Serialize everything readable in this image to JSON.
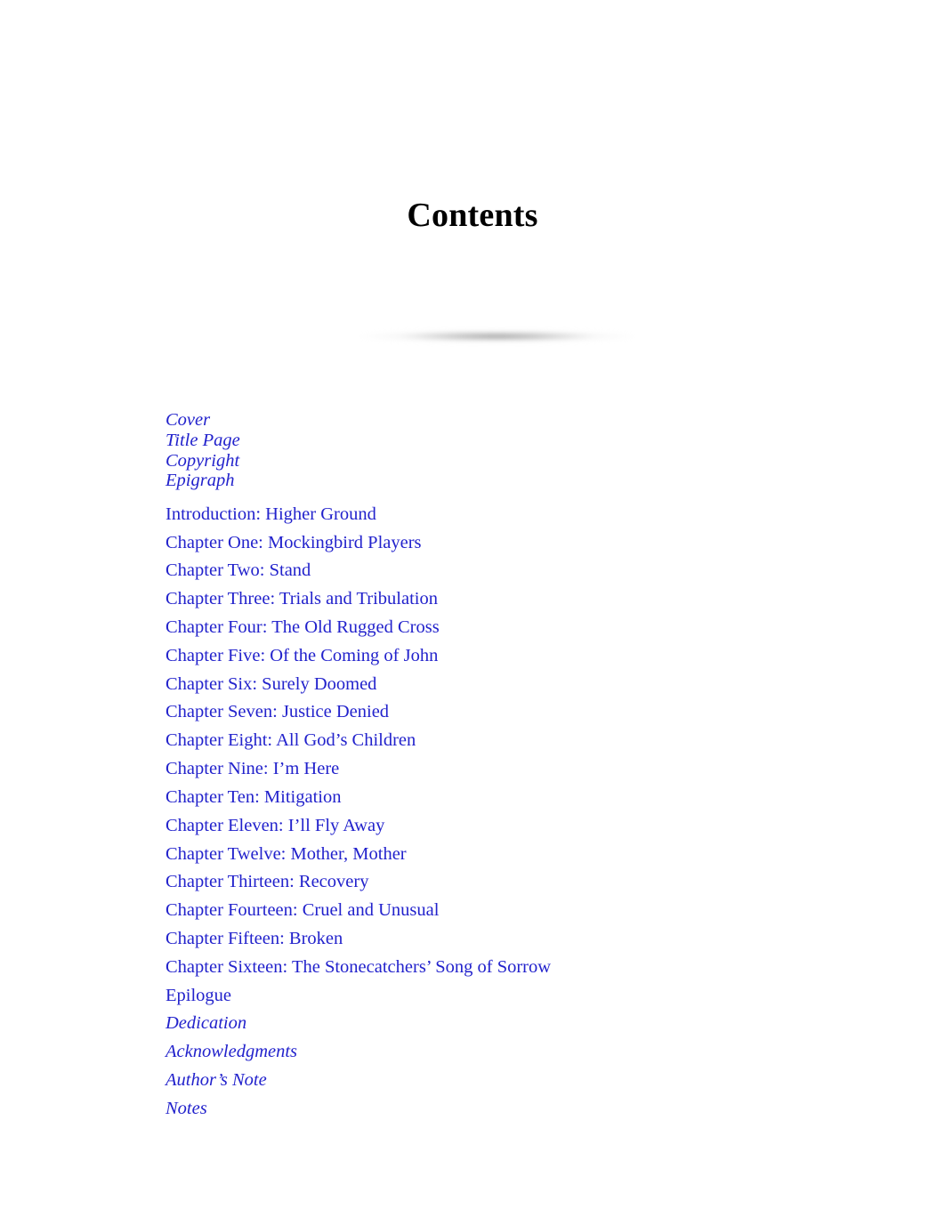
{
  "document": {
    "title": "Contents"
  },
  "redacted": {
    "name": "blurred-redacted-bar"
  },
  "toc": {
    "front_matter": [
      {
        "label": "Cover"
      },
      {
        "label": "Title Page"
      },
      {
        "label": "Copyright"
      },
      {
        "label": "Epigraph"
      }
    ],
    "chapters": [
      {
        "label": "Introduction: Higher Ground"
      },
      {
        "label": "Chapter One: Mockingbird Players"
      },
      {
        "label": "Chapter Two: Stand"
      },
      {
        "label": "Chapter Three: Trials and Tribulation"
      },
      {
        "label": "Chapter Four: The Old Rugged Cross"
      },
      {
        "label": "Chapter Five: Of the Coming of John"
      },
      {
        "label": "Chapter Six: Surely Doomed"
      },
      {
        "label": "Chapter Seven: Justice Denied"
      },
      {
        "label": "Chapter Eight: All God’s Children"
      },
      {
        "label": "Chapter Nine: I’m Here"
      },
      {
        "label": "Chapter Ten: Mitigation"
      },
      {
        "label": "Chapter Eleven: I’ll Fly Away"
      },
      {
        "label": "Chapter Twelve: Mother, Mother"
      },
      {
        "label": "Chapter Thirteen: Recovery"
      },
      {
        "label": "Chapter Fourteen: Cruel and Unusual"
      },
      {
        "label": "Chapter Fifteen: Broken"
      },
      {
        "label": "Chapter Sixteen: The Stonecatchers’ Song of Sorrow"
      },
      {
        "label": "Epilogue"
      }
    ],
    "back_matter": [
      {
        "label": "Dedication"
      },
      {
        "label": "Acknowledgments"
      },
      {
        "label": "Author’s Note"
      },
      {
        "label": "Notes"
      }
    ]
  },
  "colors": {
    "link": "#2222cc",
    "text": "#000000",
    "background": "#ffffff",
    "redacted_bar": "#b9b9b9"
  }
}
